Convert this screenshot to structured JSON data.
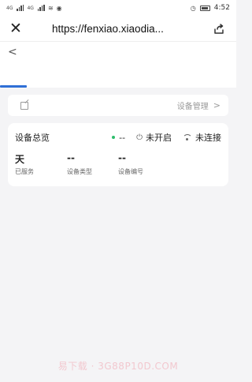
{
  "status_bar": {
    "carrier_left": "4G",
    "carrier_right": "4G",
    "time": "4:52"
  },
  "url_bar": {
    "close_glyph": "✕",
    "url": "https://fenxiao.xiaodia..."
  },
  "app_header": {
    "back_glyph": "<"
  },
  "management": {
    "label": "设备管理",
    "chevron": ">"
  },
  "overview": {
    "title": "设备总览",
    "online_count": "--",
    "power_status": "未开启",
    "network_status": "未连接",
    "stats": [
      {
        "value": "天",
        "label": "已服务"
      },
      {
        "value": "--",
        "label": "设备类型"
      },
      {
        "value": "--",
        "label": "设备编号"
      }
    ]
  },
  "watermark": "易下载 · 3G88P10D.COM",
  "colors": {
    "accent": "#2f6fd6",
    "online_dot": "#2ebd6b",
    "background": "#f4f4f6"
  },
  "icons": [
    "close-icon",
    "share-icon",
    "back-icon",
    "edit-icon",
    "chevron-right-icon",
    "status-dot-icon",
    "power-icon",
    "wifi-icon"
  ]
}
